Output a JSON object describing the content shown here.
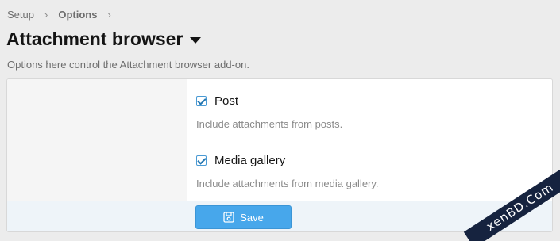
{
  "breadcrumb": {
    "items": [
      "Setup",
      "Options"
    ]
  },
  "page": {
    "title": "Attachment browser",
    "description": "Options here control the Attachment browser add-on."
  },
  "options": [
    {
      "label": "Post",
      "checked": true,
      "hint": "Include attachments from posts."
    },
    {
      "label": "Media gallery",
      "checked": true,
      "hint": "Include attachments from media gallery."
    }
  ],
  "footer": {
    "save_label": "Save",
    "save_icon": "save-icon"
  },
  "watermark": {
    "text": "xenBD.Com"
  },
  "colors": {
    "accent": "#47a7eb",
    "footer_bg": "#eef4f9"
  }
}
